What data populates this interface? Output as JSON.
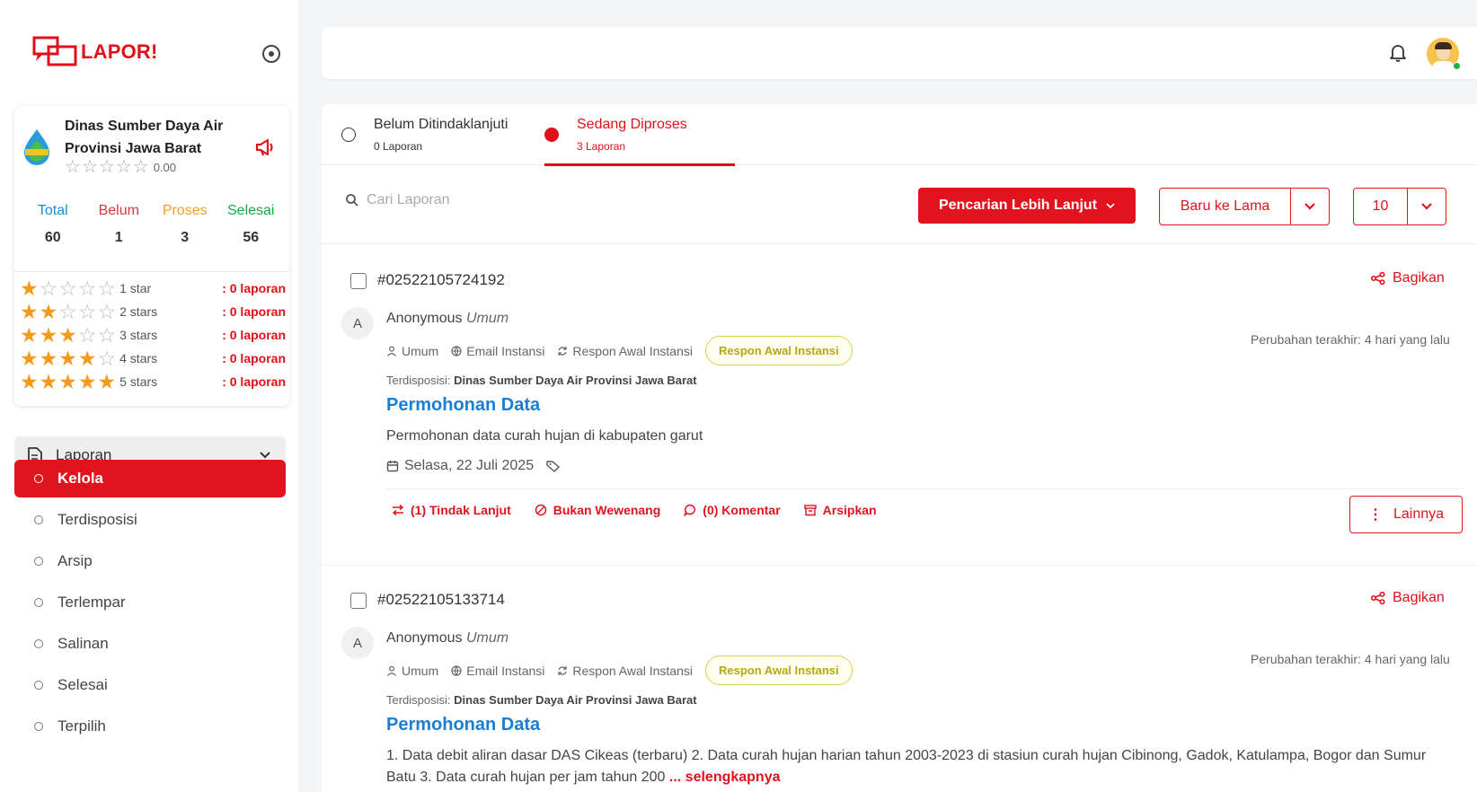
{
  "app": {
    "logo_text": "LAPOR!"
  },
  "org": {
    "name_line1": "Dinas Sumber Daya Air",
    "name_line2": "Provinsi Jawa Barat",
    "rating": "0.00"
  },
  "stats": {
    "labels": [
      "Total",
      "Belum",
      "Proses",
      "Selesai"
    ],
    "values": [
      "60",
      "1",
      "3",
      "56"
    ]
  },
  "star_breakdown": [
    {
      "stars": 1,
      "label": "1 star",
      "count": ": 0 laporan"
    },
    {
      "stars": 2,
      "label": "2 stars",
      "count": ": 0 laporan"
    },
    {
      "stars": 3,
      "label": "3 stars",
      "count": ": 0 laporan"
    },
    {
      "stars": 4,
      "label": "4 stars",
      "count": ": 0 laporan"
    },
    {
      "stars": 5,
      "label": "5 stars",
      "count": ": 0 laporan"
    }
  ],
  "sidebar": {
    "group_label": "Laporan",
    "items": [
      "Kelola",
      "Terdisposisi",
      "Arsip",
      "Terlempar",
      "Salinan",
      "Selesai",
      "Terpilih"
    ],
    "active_index": 0
  },
  "tabs": [
    {
      "title": "Belum Ditindaklanjuti",
      "count": "0 Laporan"
    },
    {
      "title": "Sedang Diproses",
      "count": "3 Laporan"
    }
  ],
  "filters": {
    "search_placeholder": "Cari Laporan",
    "advanced_label": "Pencarian Lebih Lanjut",
    "sort_label": "Baru ke Lama",
    "per_page": "10"
  },
  "reports": [
    {
      "id": "#02522105724192",
      "share_label": "Bagikan",
      "avatar_letter": "A",
      "author": "Anonymous",
      "category": "Umum",
      "meta": [
        "Umum",
        "Email Instansi",
        "Respon Awal Instansi"
      ],
      "badge": "Respon Awal Instansi",
      "changed": "Perubahan terakhir: 4 hari yang lalu",
      "dispo_label": "Terdisposisi:",
      "dispo_value": "Dinas Sumber Daya Air Provinsi Jawa Barat",
      "title": "Permohonan Data",
      "description": "Permohonan data curah hujan di kabupaten garut",
      "date": "Selasa, 22 Juli 2025",
      "actions": [
        "(1) Tindak Lanjut",
        "Bukan Wewenang",
        "(0) Komentar",
        "Arsipkan"
      ],
      "more_label": "Lainnya"
    },
    {
      "id": "#02522105133714",
      "share_label": "Bagikan",
      "avatar_letter": "A",
      "author": "Anonymous",
      "category": "Umum",
      "meta": [
        "Umum",
        "Email Instansi",
        "Respon Awal Instansi"
      ],
      "badge": "Respon Awal Instansi",
      "changed": "Perubahan terakhir: 4 hari yang lalu",
      "dispo_label": "Terdisposisi:",
      "dispo_value": "Dinas Sumber Daya Air Provinsi Jawa Barat",
      "title": "Permohonan Data",
      "description": "1. Data debit aliran dasar DAS Cikeas (terbaru) 2. Data curah hujan harian tahun 2003-2023 di stasiun curah hujan Cibinong, Gadok, Katulampa, Bogor dan Sumur Batu 3. Data curah hujan per jam tahun 200",
      "read_more": "... selengkapnya"
    }
  ],
  "colors": {
    "brand": "#e0131f",
    "link": "#1a7fd4",
    "badge": "#b6a914"
  }
}
